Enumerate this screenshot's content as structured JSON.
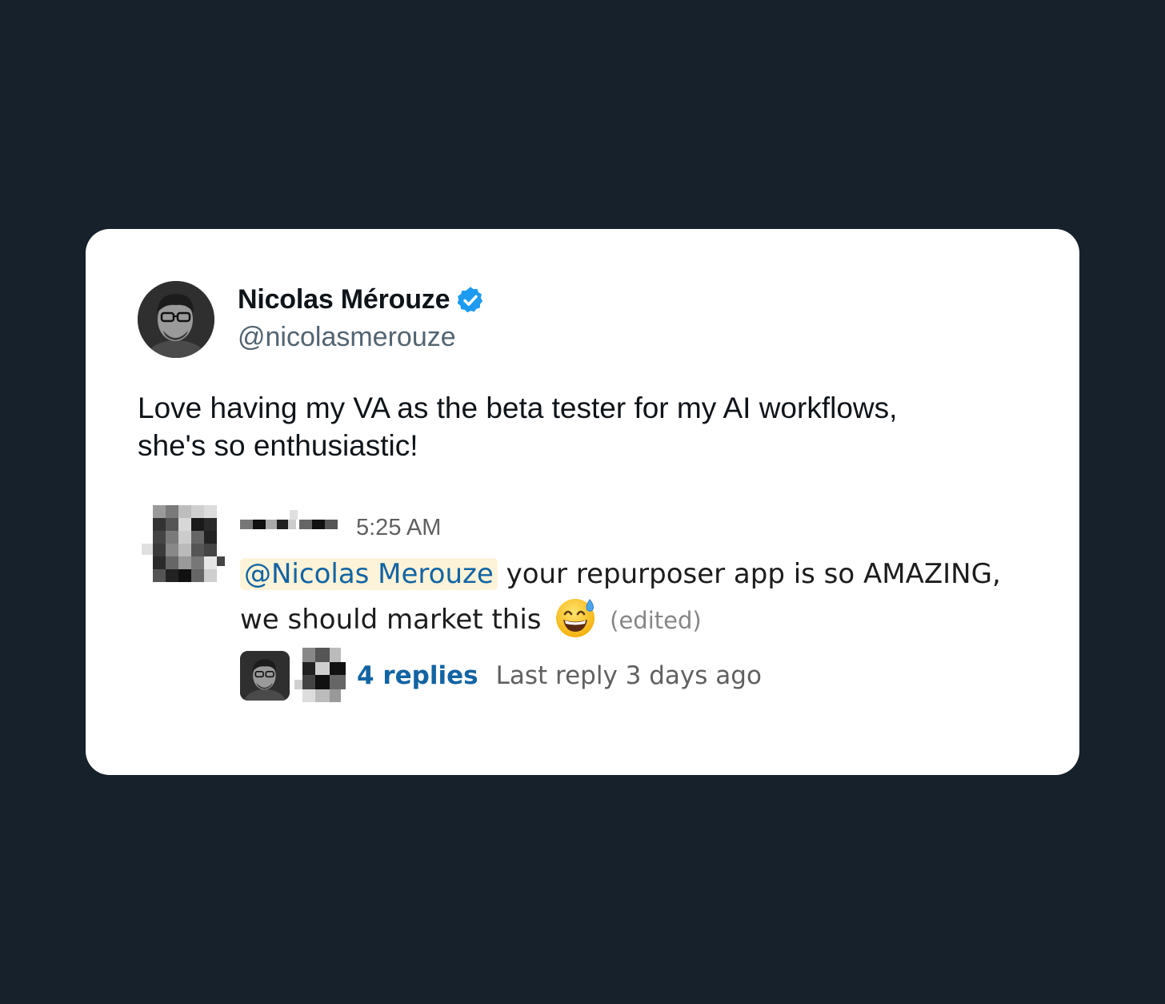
{
  "tweet": {
    "author_name": "Nicolas Mérouze",
    "handle": "@nicolasmerouze",
    "verified": true,
    "verified_color": "#1d9bf0",
    "text_lines": [
      "Love having my VA as the beta tester for my AI workflows,",
      "she's so enthusiastic!"
    ]
  },
  "embedded_message": {
    "sender_name_blurred": true,
    "time": "5:25 AM",
    "mention": "@Nicolas Merouze",
    "text_after_mention": " your repurposer app is so AMAZING,",
    "text_line2": "we should market this",
    "emoji": "grinning-face-with-sweat-emoji",
    "edited_label": "(edited)",
    "replies_label": "4 replies",
    "last_reply": "Last reply 3 days ago"
  },
  "colors": {
    "background": "#17212b",
    "card": "#ffffff",
    "link_blue": "#1264a3",
    "mention_bg": "#fdf3d8"
  }
}
